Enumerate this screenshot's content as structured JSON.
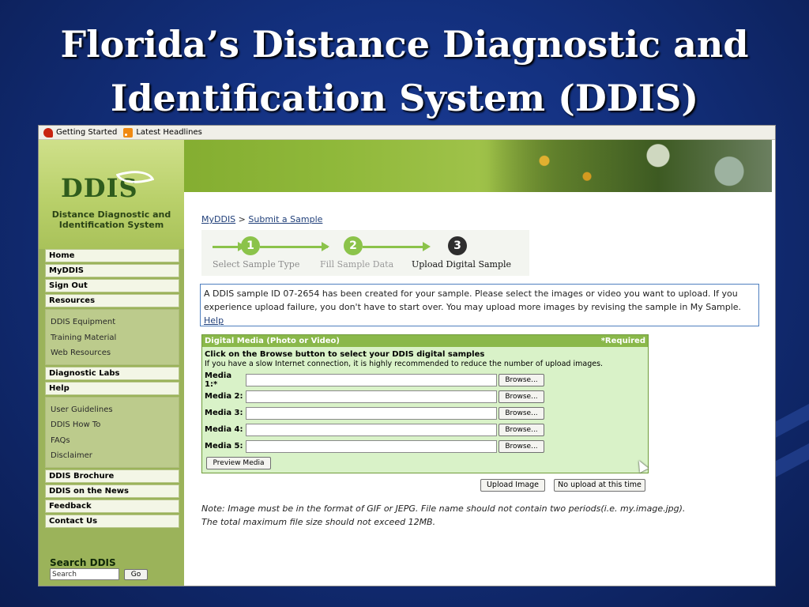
{
  "slide": {
    "title_line1": "Florida’s Distance Diagnostic and",
    "title_line2": "Identification System (DDIS)"
  },
  "browser": {
    "bookmarks": [
      {
        "label": "Getting Started",
        "icon": "firefox-bookmark-icon"
      },
      {
        "label": "Latest Headlines",
        "icon": "rss-feed-icon"
      }
    ]
  },
  "site": {
    "logo_text": "DDIS",
    "logo_subtitle_line1": "Distance Diagnostic and",
    "logo_subtitle_line2": "Identification System"
  },
  "sidebar": {
    "nav_top": [
      "Home",
      "MyDDIS",
      "Sign Out",
      "Resources"
    ],
    "resources_sub": [
      "DDIS Equipment",
      "Training Material",
      "Web Resources"
    ],
    "nav_mid": [
      "Diagnostic Labs",
      "Help"
    ],
    "help_sub": [
      "User Guidelines",
      "DDIS How To",
      "FAQs",
      "Disclaimer"
    ],
    "nav_bottom": [
      "DDIS Brochure",
      "DDIS on the News",
      "Feedback",
      "Contact Us"
    ],
    "search_title": "Search DDIS",
    "search_placeholder": "Search",
    "go_label": "Go"
  },
  "main": {
    "breadcrumb": {
      "root": "MyDDIS",
      "separator": ">",
      "current": "Submit a Sample"
    },
    "steps": [
      {
        "number": "1",
        "label": "Select Sample Type",
        "state": "done"
      },
      {
        "number": "2",
        "label": "Fill Sample Data",
        "state": "done"
      },
      {
        "number": "3",
        "label": "Upload Digital Sample",
        "state": "current"
      }
    ],
    "notice_text": "A DDIS sample ID 07-2654 has been created for your sample. Please select the images or video you want to upload. If you experience upload failure, you don't have to start over. You may upload more images by revising the sample in My Sample.",
    "notice_link": "Help",
    "media": {
      "header_title": "Digital Media (Photo or Video)",
      "header_required": "*Required",
      "instruction_bold": "Click on the Browse button to select your DDIS digital samples",
      "instruction_text": "If you have a slow Internet connection, it is highly recommended to reduce the number of upload images.",
      "rows": [
        {
          "label": "Media 1:*",
          "value": "",
          "button": "Browse..."
        },
        {
          "label": "Media 2:",
          "value": "",
          "button": "Browse..."
        },
        {
          "label": "Media 3:",
          "value": "",
          "button": "Browse..."
        },
        {
          "label": "Media 4:",
          "value": "",
          "button": "Browse..."
        },
        {
          "label": "Media 5:",
          "value": "",
          "button": "Browse..."
        }
      ],
      "preview_label": "Preview Media"
    },
    "upload_label": "Upload Image",
    "no_upload_label": "No upload at this time",
    "note_line1": "Note: Image must be in the format of GIF or JEPG. File name should not contain two periods(i.e. my.image.jpg).",
    "note_line2": "The total maximum file size should not exceed 12MB."
  },
  "colors": {
    "slide_bg": "#13307e",
    "sidebar_green": "#9bb35a",
    "media_bg": "#d9f2c8",
    "media_header": "#8ab84a",
    "step_done": "#8bc34a",
    "step_current": "#2e2e2e",
    "link": "#21407a"
  }
}
